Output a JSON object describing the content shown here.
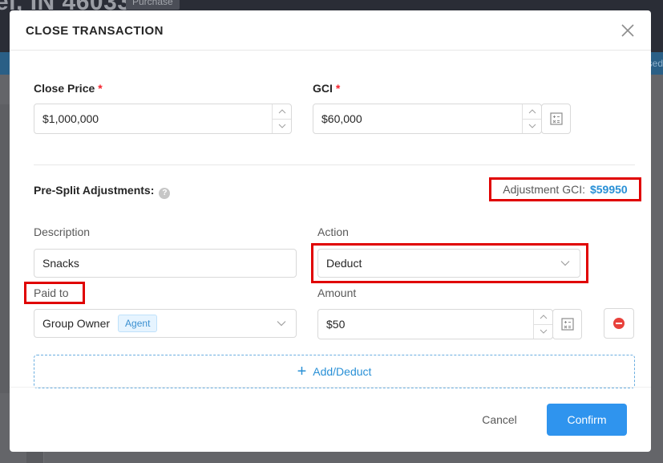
{
  "background": {
    "title": "el, IN 46033",
    "badge": "Purchase",
    "right_text": "sed"
  },
  "modal": {
    "title": "CLOSE TRANSACTION",
    "close_price": {
      "label": "Close Price",
      "required": "*",
      "value": "$1,000,000"
    },
    "gci": {
      "label": "GCI",
      "required": "*",
      "value": "$60,000"
    },
    "pre_split": {
      "label": "Pre-Split Adjustments:",
      "help": "?",
      "adjustment_gci_label": "Adjustment GCI:",
      "adjustment_gci_value": "$59950"
    },
    "row": {
      "description_label": "Description",
      "description_value": "Snacks",
      "action_label": "Action",
      "action_value": "Deduct",
      "paid_to_label": "Paid to",
      "paid_to_value": "Group Owner",
      "paid_to_tag": "Agent",
      "amount_label": "Amount",
      "amount_value": "$50"
    },
    "add_deduct": {
      "icon": "+",
      "label": "Add/Deduct"
    },
    "footer": {
      "cancel": "Cancel",
      "confirm": "Confirm"
    }
  },
  "colors": {
    "primary": "#2f94ee",
    "highlight": "#e00000",
    "required": "#f5222d",
    "value_blue": "#2990d6"
  }
}
